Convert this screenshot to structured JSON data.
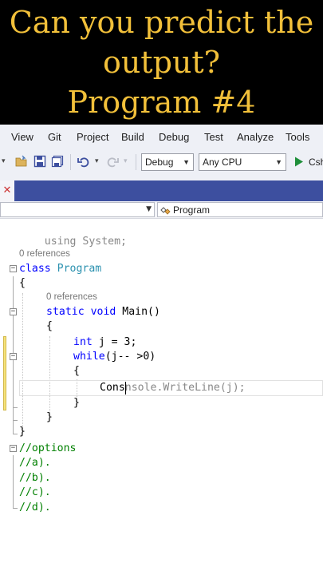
{
  "banner": {
    "line1": "Can you predict the",
    "line2": "output?",
    "line3": "Program #4"
  },
  "menu": [
    "View",
    "Git",
    "Project",
    "Build",
    "Debug",
    "Test",
    "Analyze",
    "Tools"
  ],
  "toolbar": {
    "config": "Debug",
    "platform": "Any CPU",
    "run_label": "Csh"
  },
  "tab": {
    "close_glyph": "✕"
  },
  "navbar": {
    "member": "Program"
  },
  "code": {
    "line_using": "using System;",
    "refs_class": "0 references",
    "class_kw": "class",
    "class_name": "Program",
    "brace_open": "{",
    "brace_close": "}",
    "refs_main": "0 references",
    "main_static": "static",
    "main_void": "void",
    "main_sig": " Main()",
    "int_kw": "int",
    "int_rest": " j = 3;",
    "while_kw": "while",
    "while_rest": "(j-- >0)",
    "line_cons": "Cons",
    "line_cons_ghost": "nsole.WriteLine(j);",
    "opt_header": "//options",
    "opt_a": "//a).",
    "opt_b": "//b).",
    "opt_c": "//c).",
    "opt_d": "//d)."
  },
  "colors": {
    "banner_text": "#f2c03a",
    "keyword": "#0000ff",
    "type": "#2b91af",
    "comment": "#008000",
    "tab_bar": "#3d4f9f"
  }
}
